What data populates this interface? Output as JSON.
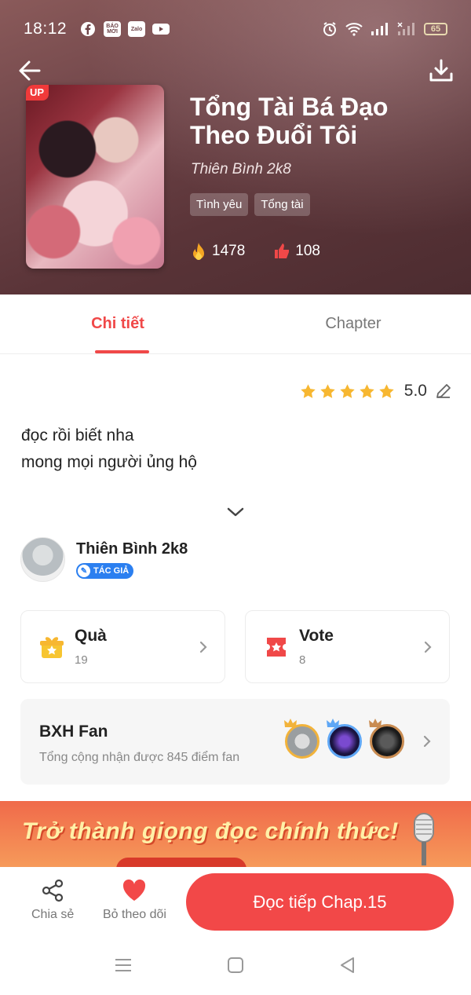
{
  "status_bar": {
    "time": "18:12",
    "app_icons": [
      "facebook-icon",
      "baomoi-icon",
      "zalo-icon",
      "youtube-icon"
    ],
    "baomoi_label": "BÁO MỚI",
    "zalo_label": "Zalo",
    "battery": "65"
  },
  "book": {
    "badge": "UP",
    "title": "Tổng Tài Bá Đạo Theo Đuổi Tôi",
    "author": "Thiên Bình 2k8",
    "tags": [
      "Tình yêu",
      "Tổng tài"
    ],
    "views": "1478",
    "likes": "108"
  },
  "tabs": [
    {
      "label": "Chi tiết",
      "active": true
    },
    {
      "label": "Chapter",
      "active": false
    }
  ],
  "rating": {
    "value": "5.0",
    "stars": 5
  },
  "description": [
    "đọc rồi biết nha",
    "mong mọi người ủng hộ"
  ],
  "author_card": {
    "name": "Thiên Bình 2k8",
    "badge": "TÁC GIẢ"
  },
  "gift_card": {
    "title": "Quà",
    "count": "19"
  },
  "vote_card": {
    "title": "Vote",
    "count": "8"
  },
  "fan_rank": {
    "title": "BXH Fan",
    "subtitle": "Tổng cộng nhận được 845 điểm fan"
  },
  "banner": {
    "text": "Trở thành giọng đọc chính thức!"
  },
  "bottom_bar": {
    "share_label": "Chia sẻ",
    "unfollow_label": "Bỏ theo dõi",
    "read_label": "Đọc tiếp Chap.15"
  },
  "colors": {
    "accent": "#f24848",
    "gold": "#f2b33b",
    "author_badge": "#2b7ff0"
  }
}
